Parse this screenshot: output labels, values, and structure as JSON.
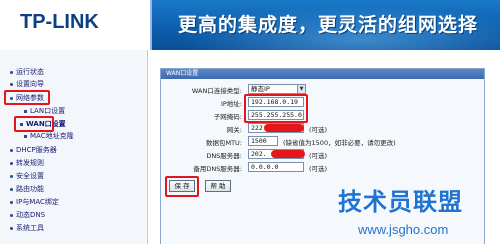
{
  "header": {
    "logo_text": "TP-LINK",
    "slogan": "更高的集成度，更灵活的组网选择"
  },
  "sidebar": {
    "items": [
      {
        "label": "运行状态"
      },
      {
        "label": "设置向导"
      },
      {
        "label": "网络参数"
      },
      {
        "label": "LAN口设置"
      },
      {
        "label": "WAN口设置"
      },
      {
        "label": "MAC地址克隆"
      },
      {
        "label": "DHCP服务器"
      },
      {
        "label": "转发规则"
      },
      {
        "label": "安全设置"
      },
      {
        "label": "路由功能"
      },
      {
        "label": "IP与MAC绑定"
      },
      {
        "label": "动态DNS"
      },
      {
        "label": "系统工具"
      }
    ]
  },
  "panel": {
    "title": "WAN口设置",
    "rows": {
      "conn_type": {
        "label": "WAN口连接类型:",
        "value": "静态IP"
      },
      "ip": {
        "label": "IP地址:",
        "value": "192.168.0.19"
      },
      "mask": {
        "label": "子网掩码:",
        "value": "255.255.255.0"
      },
      "gateway": {
        "label": "网关:",
        "value": "222",
        "hint": "(可选)"
      },
      "mtu": {
        "label": "数据包MTU:",
        "value": "1500",
        "hint": "(缺省值为1500，如非必要，请勿更改)"
      },
      "dns1": {
        "label": "DNS服务器:",
        "value": "202.",
        "hint": "(可选)"
      },
      "dns2": {
        "label": "备用DNS服务器:",
        "value": "0.0.0.0",
        "hint": "(可选)"
      }
    },
    "save_label": "保 存",
    "help_label": "帮 助"
  },
  "watermark": {
    "title": "技术员联盟",
    "url": "www.jsgho.com"
  },
  "colors": {
    "header_blue": "#0d5fae",
    "highlight_red": "#e3171b",
    "watermark_blue": "#1f73d1"
  }
}
